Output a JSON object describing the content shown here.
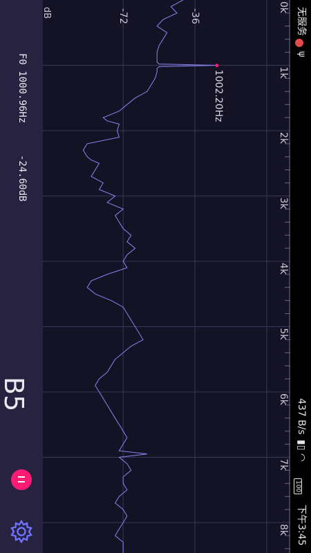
{
  "status_bar": {
    "carrier": "无服务",
    "network_speed": "437 B/s",
    "battery": "100",
    "time": "下午3:45"
  },
  "readout": {
    "f0": "F0  1000.96Hz",
    "level": "-24.60dB",
    "note": "B5"
  },
  "controls": {
    "pause_icon": "pause-icon",
    "settings_icon": "gear-icon"
  },
  "colors": {
    "background": "#141225",
    "panel": "#262240",
    "trace": "#8a86f5",
    "accent": "#ff1a73"
  },
  "chart_data": {
    "type": "line",
    "title": "",
    "xlabel": "",
    "ylabel": "dB",
    "x_unit": "Hz",
    "xlim": [
      0,
      8500
    ],
    "ylim": [
      -110,
      0
    ],
    "x_ticks": [
      "0k",
      "1k",
      "2k",
      "3k",
      "4k",
      "5k",
      "6k",
      "7k",
      "8k"
    ],
    "y_ticks": [
      "-36",
      "-72"
    ],
    "peak_label": "1002.20Hz",
    "peak": [
      1002.2,
      -25
    ],
    "grid": true,
    "series": [
      {
        "x": [
          0,
          100,
          200,
          300,
          400,
          500,
          600,
          700,
          800,
          900,
          950,
          980,
          1000,
          1020,
          1050,
          1100,
          1200,
          1300,
          1400,
          1500,
          1600,
          1700,
          1800,
          1850,
          1900,
          2000,
          2100,
          2200,
          2300,
          2400,
          2450,
          2500,
          2600,
          2700,
          2800,
          2900,
          3000,
          3100,
          3200,
          3300,
          3400,
          3500,
          3600,
          3700,
          3800,
          3900,
          4000,
          4100,
          4200,
          4300,
          4400,
          4500,
          4600,
          4700,
          4800,
          4900,
          5000,
          5100,
          5200,
          5300,
          5400,
          5500,
          5600,
          5700,
          5800,
          5900,
          6000,
          6100,
          6200,
          6300,
          6400,
          6500,
          6600,
          6700,
          6800,
          6900,
          6950,
          7000,
          7050,
          7100,
          7200,
          7300,
          7400,
          7500,
          7600,
          7700,
          7800,
          7900,
          8000,
          8100,
          8200,
          8300,
          8500
        ],
        "y": [
          -42,
          -48,
          -45,
          -52,
          -55,
          -50,
          -52,
          -54,
          -55,
          -55,
          -55,
          -54,
          -25,
          -54,
          -55,
          -55,
          -56,
          -58,
          -60,
          -66,
          -70,
          -74,
          -82,
          -80,
          -74,
          -75,
          -74,
          -90,
          -92,
          -90,
          -88,
          -84,
          -86,
          -88,
          -82,
          -84,
          -76,
          -80,
          -72,
          -76,
          -74,
          -72,
          -68,
          -70,
          -66,
          -70,
          -72,
          -70,
          -80,
          -88,
          -90,
          -86,
          -78,
          -72,
          -70,
          -68,
          -66,
          -64,
          -62,
          -68,
          -72,
          -76,
          -78,
          -80,
          -84,
          -86,
          -84,
          -82,
          -80,
          -78,
          -76,
          -74,
          -72,
          -70,
          -72,
          -74,
          -60,
          -74,
          -72,
          -70,
          -68,
          -72,
          -72,
          -70,
          -74,
          -76,
          -72,
          -70,
          -72,
          -74,
          -76,
          -72,
          -72
        ]
      }
    ]
  }
}
